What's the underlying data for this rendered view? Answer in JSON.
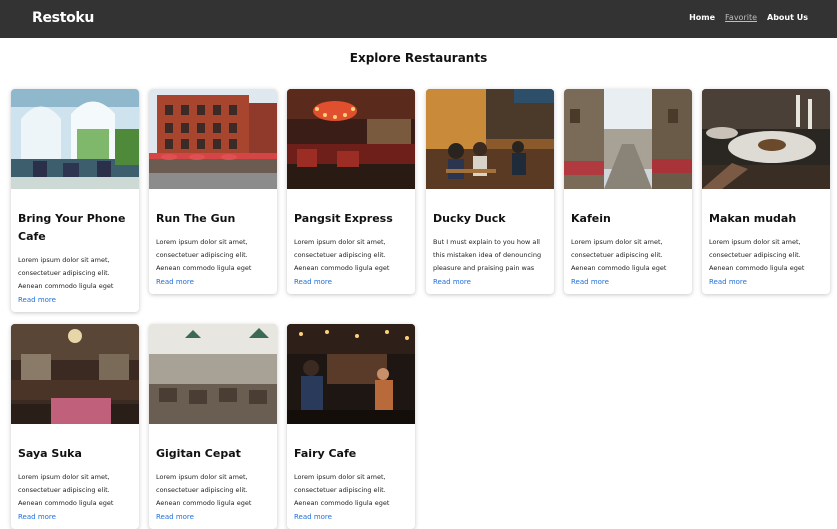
{
  "navbar": {
    "brand": "Restoku",
    "links": [
      "Home",
      "Favorite",
      "About Us"
    ]
  },
  "page_title": "Explore Restaurants",
  "restaurants": [
    {
      "name": "Bring Your Phone Cafe",
      "description": "Lorem ipsum dolor sit amet, consectetuer adipiscing elit. Aenean commodo ligula eget dolor.",
      "link": "Read more",
      "image": "restaurant-greenhouse-interior-photo"
    },
    {
      "name": "Run The Gun",
      "description": "Lorem ipsum dolor sit amet, consectetuer adipiscing elit. Aenean commodo ligula eget dolor.",
      "link": "Read more",
      "image": "brick-building-street-photo"
    },
    {
      "name": "Pangsit Express",
      "description": "Lorem ipsum dolor sit amet, consectetuer adipiscing elit. Aenean commodo ligula eget dolor.",
      "link": "Read more",
      "image": "chandelier-bar-interior-photo"
    },
    {
      "name": "Ducky Duck",
      "description": "But I must explain to you how all this mistaken idea of denouncing pleasure and praising pain was born.",
      "link": "Read more",
      "image": "cafe-terrace-diners-photo"
    },
    {
      "name": "Kafein",
      "description": "Lorem ipsum dolor sit amet, consectetuer adipiscing elit. Aenean commodo ligula eget dolor.",
      "link": "Read more",
      "image": "narrow-street-dining-photo"
    },
    {
      "name": "Makan mudah",
      "description": "Lorem ipsum dolor sit amet, consectetuer adipiscing elit. Aenean commodo ligula eget dolor.",
      "link": "Read more",
      "image": "plated-dish-table-photo"
    },
    {
      "name": "Saya Suka",
      "description": "Lorem ipsum dolor sit amet, consectetuer adipiscing elit. Aenean commodo ligula eget dolor.",
      "link": "Read more",
      "image": "vintage-dining-room-photo"
    },
    {
      "name": "Gigitan Cepat",
      "description": "Lorem ipsum dolor sit amet, consectetuer adipiscing elit. Aenean commodo ligula eget dolor.",
      "link": "Read more",
      "image": "bright-cafe-interior-photo"
    },
    {
      "name": "Fairy Cafe",
      "description": "Lorem ipsum dolor sit amet, consectetuer adipiscing elit. Aenean commodo ligula eget dolor.",
      "link": "Read more",
      "image": "crowded-bar-photo"
    }
  ]
}
